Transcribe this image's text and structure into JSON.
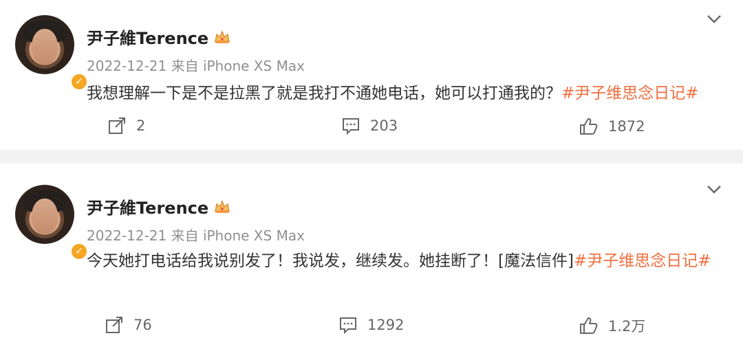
{
  "posts": [
    {
      "username": "尹子維Terence",
      "meta": "2022-12-21 来自 iPhone XS Max",
      "text": "我想理解一下是不是拉黑了就是我打不通她电话，她可以打通我的？",
      "topic": "#尹子维思念日记#",
      "share_count": "2",
      "comment_count": "203",
      "like_count": "1872"
    },
    {
      "username": "尹子維Terence",
      "meta": "2022-12-21 来自 iPhone XS Max",
      "text": "今天她打电话给我说别发了！我说发，继续发。她挂断了！[魔法信件]",
      "topic": "#尹子维思念日记#",
      "share_count": "76",
      "comment_count": "1292",
      "like_count": "1.2万"
    }
  ],
  "icons": {
    "verified": "verified-badge-icon",
    "crown": "vip-crown-icon",
    "share": "share-icon",
    "comment": "comment-icon",
    "like": "thumbs-up-icon",
    "menu": "chevron-down-icon"
  },
  "colors": {
    "topic": "#f26e3f",
    "verified": "#f5a623",
    "background_gap": "#f2f2f2"
  }
}
